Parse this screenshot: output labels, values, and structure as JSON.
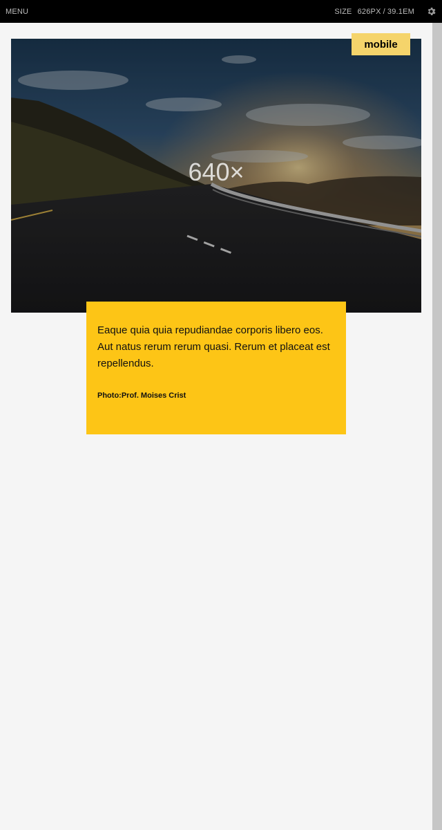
{
  "toolbar": {
    "menu_label": "MENU",
    "size_label": "SIZE",
    "size_px": "626PX",
    "size_separator": "/",
    "size_em": "39.1EM",
    "settings_icon": "gear-icon"
  },
  "hero": {
    "placeholder_label": "640×",
    "image_alt": "Road at sunset"
  },
  "badge": {
    "label": "mobile"
  },
  "caption": {
    "text": "Eaque quia quia repudiandae corporis libero eos. Aut natus rerum rerum quasi. Rerum et placeat est repellendus.",
    "credit": "Photo:Prof. Moises Crist"
  },
  "colors": {
    "toolbar_bg": "#000000",
    "page_bg": "#f5f5f5",
    "card_bg": "#fdc516",
    "badge_bg": "#f5d46b"
  }
}
